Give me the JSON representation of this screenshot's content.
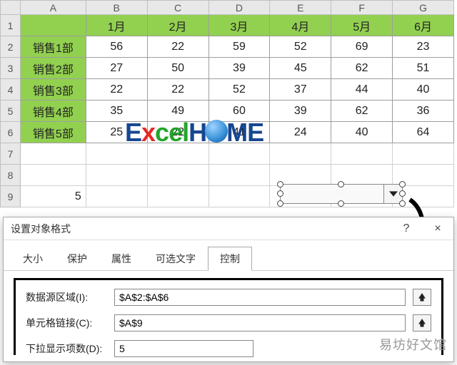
{
  "columns": [
    "A",
    "B",
    "C",
    "D",
    "E",
    "F",
    "G"
  ],
  "row_numbers": [
    1,
    2,
    3,
    4,
    5,
    6,
    7,
    8,
    9
  ],
  "months": [
    "1月",
    "2月",
    "3月",
    "4月",
    "5月",
    "6月"
  ],
  "rows": [
    {
      "label": "销售1部",
      "vals": [
        56,
        22,
        59,
        52,
        69,
        23
      ]
    },
    {
      "label": "销售2部",
      "vals": [
        27,
        50,
        39,
        45,
        62,
        51
      ]
    },
    {
      "label": "销售3部",
      "vals": [
        22,
        22,
        52,
        37,
        44,
        40
      ]
    },
    {
      "label": "销售4部",
      "vals": [
        35,
        49,
        60,
        39,
        62,
        36
      ]
    },
    {
      "label": "销售5部",
      "vals": [
        25,
        22,
        41,
        24,
        40,
        64
      ]
    }
  ],
  "a9_value": "5",
  "logo": {
    "text": "ExcelHOME"
  },
  "dialog": {
    "title": "设置对象格式",
    "help": "?",
    "close": "×",
    "tabs": [
      "大小",
      "保护",
      "属性",
      "可选文字",
      "控制"
    ],
    "active_tab": 4,
    "fields": {
      "input_range_label": "数据源区域(I):",
      "input_range_value": "$A$2:$A$6",
      "cell_link_label": "单元格链接(C):",
      "cell_link_value": "$A$9",
      "dropdown_lines_label": "下拉显示项数(D):",
      "dropdown_lines_value": "5"
    }
  },
  "watermark": "易坊好文馆"
}
